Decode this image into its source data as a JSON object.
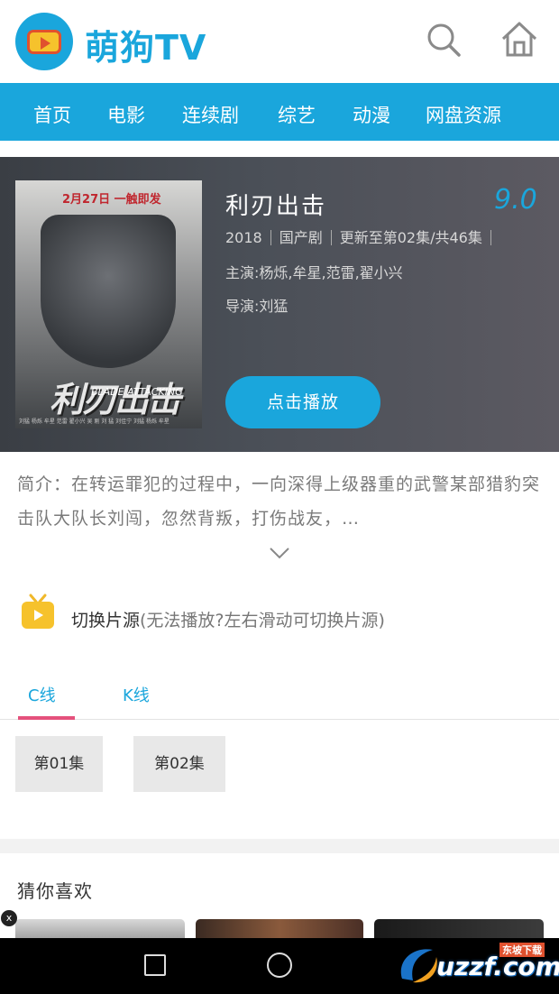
{
  "header": {
    "brand": "萌狗TV"
  },
  "nav": {
    "items": [
      "首页",
      "电影",
      "连续剧",
      "综艺",
      "动漫",
      "网盘资源"
    ]
  },
  "movie": {
    "title": "利刃出击",
    "score": "9.0",
    "year": "2018",
    "region": "国产剧",
    "update": "更新至第02集/共46集",
    "cast": "主演:杨烁,牟星,范雷,翟小兴",
    "director": "导演:刘猛",
    "play_label": "点击播放",
    "synopsis": "简介：在转运罪犯的过程中，一向深得上级器重的武警某部猎豹突击队大队长刘闯，忽然背叛，打伤战友，…",
    "poster": {
      "date_text": "2月27日  一触即发",
      "title_text": "利刃出击",
      "subtitle_text": "BLADE ATTACKING",
      "credits_text": "刘猛 杨烁 牟星 范雷 翟小兴 吴 刚 刘 猛 刘佳宁 刘猛 杨烁 牟星"
    }
  },
  "source": {
    "title": "切换片源",
    "hint": "(无法播放?左右滑动可切换片源)",
    "tabs": [
      "C线",
      "K线"
    ],
    "active_tab": 0,
    "episodes": [
      "第01集",
      "第02集"
    ]
  },
  "recommend": {
    "title": "猜你喜欢",
    "close": "x"
  },
  "watermark": {
    "text": "uzzf.com",
    "sub": "东坡下载"
  },
  "colors": {
    "accent": "#1aa6dc",
    "tab_indicator": "#e5517c"
  }
}
